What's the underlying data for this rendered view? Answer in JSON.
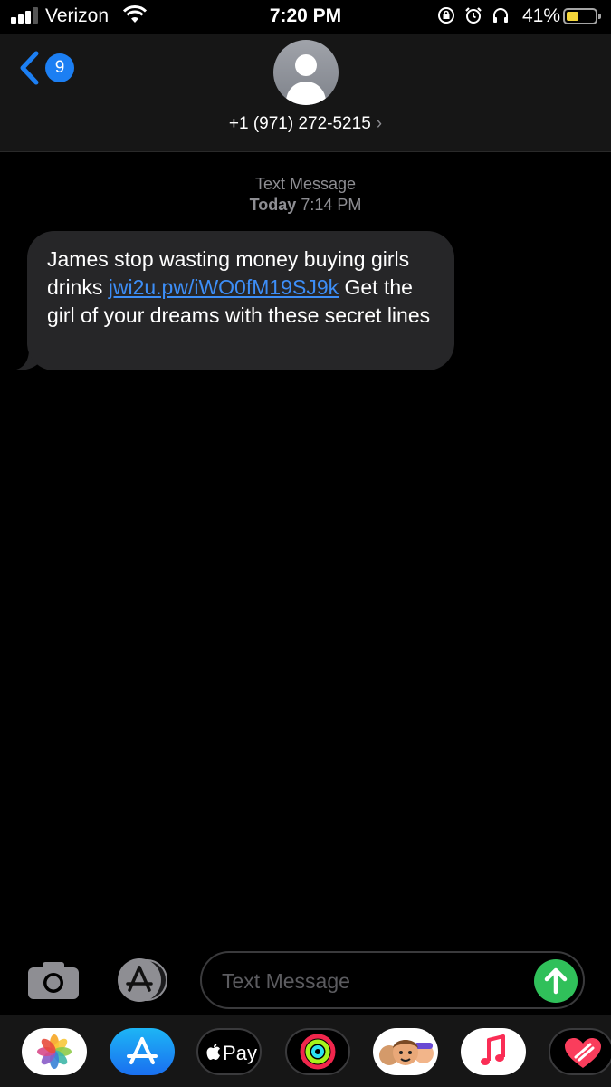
{
  "status_bar": {
    "carrier": "Verizon",
    "time": "7:20 PM",
    "battery_percent": "41%",
    "battery_level": 0.41,
    "signal_bars": 3,
    "icons": [
      "signal-icon",
      "wifi-icon",
      "orientation-lock-icon",
      "alarm-icon",
      "headphones-icon",
      "battery-icon"
    ]
  },
  "header": {
    "back_badge_count": "9",
    "contact_name": "+1 (971) 272-5215",
    "contact_chevron": "›"
  },
  "conversation": {
    "service_label": "Text Message",
    "day_label": "Today",
    "time_label": "7:14 PM",
    "messages": [
      {
        "direction": "incoming",
        "text_before": "James stop wasting money buying girls drinks ",
        "link": "jwi2u.pw/iWO0fM19SJ9k",
        "text_after": " Get the girl of your dreams with these secret lines"
      }
    ]
  },
  "composer": {
    "placeholder": "Text Message",
    "value": ""
  },
  "app_drawer": {
    "apps": [
      "Photos",
      "App Store",
      "Apple Pay",
      "Activity",
      "Memoji",
      "Music",
      "Digital Touch"
    ],
    "apple_pay_label": "Pay"
  },
  "colors": {
    "accent": "#1c7ff3",
    "link": "#3d8ef7",
    "send": "#30c05a",
    "bubble": "#262628",
    "battery_fill": "#f4d63a"
  }
}
